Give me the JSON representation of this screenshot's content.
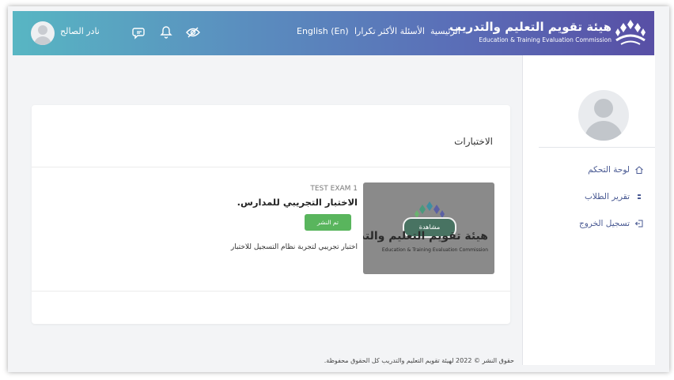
{
  "header": {
    "brand_ar": "هيئة تقويم التعليم والتدريب",
    "brand_en": "Education & Training Evaluation Commission",
    "nav": {
      "home": "الرئيسية",
      "faq": "الأسئلة الأكثر تكرارا",
      "language": "English (En)"
    },
    "user_name": "نادر الصالح",
    "icons": [
      "eye-off-icon",
      "bell-icon",
      "message-icon"
    ]
  },
  "sidebar": {
    "items": [
      {
        "label": "لوحة التحكم",
        "icon": "home-icon"
      },
      {
        "label": "تقرير الطلاب",
        "icon": "bullet-icon"
      },
      {
        "label": "تسجيل الخروج",
        "icon": "logout-icon"
      }
    ]
  },
  "main": {
    "section_title": "الاختبارات",
    "exam": {
      "code": "TEST EXAM 1",
      "title": "الاختبار التجريبي للمدارس.",
      "status": "تم النشر",
      "description": "اختبار تجريبي لتجربة نظام التسجيل للاختبار",
      "thumbnail": {
        "title_ar": "هيئة تقويم التعليم والتدريب",
        "title_en": "Education & Training Evaluation Commission",
        "badge": "مشاهدة"
      }
    }
  },
  "footer": {
    "copyright": "حقوق النشر © 2022 لهيئة تقويم التعليم والتدريب كل الحقوق محفوظة."
  },
  "colors": {
    "header_start": "#58b6c3",
    "header_end": "#584fa5",
    "sidebar_link": "#4a5a93",
    "published_green": "#59b55d"
  }
}
